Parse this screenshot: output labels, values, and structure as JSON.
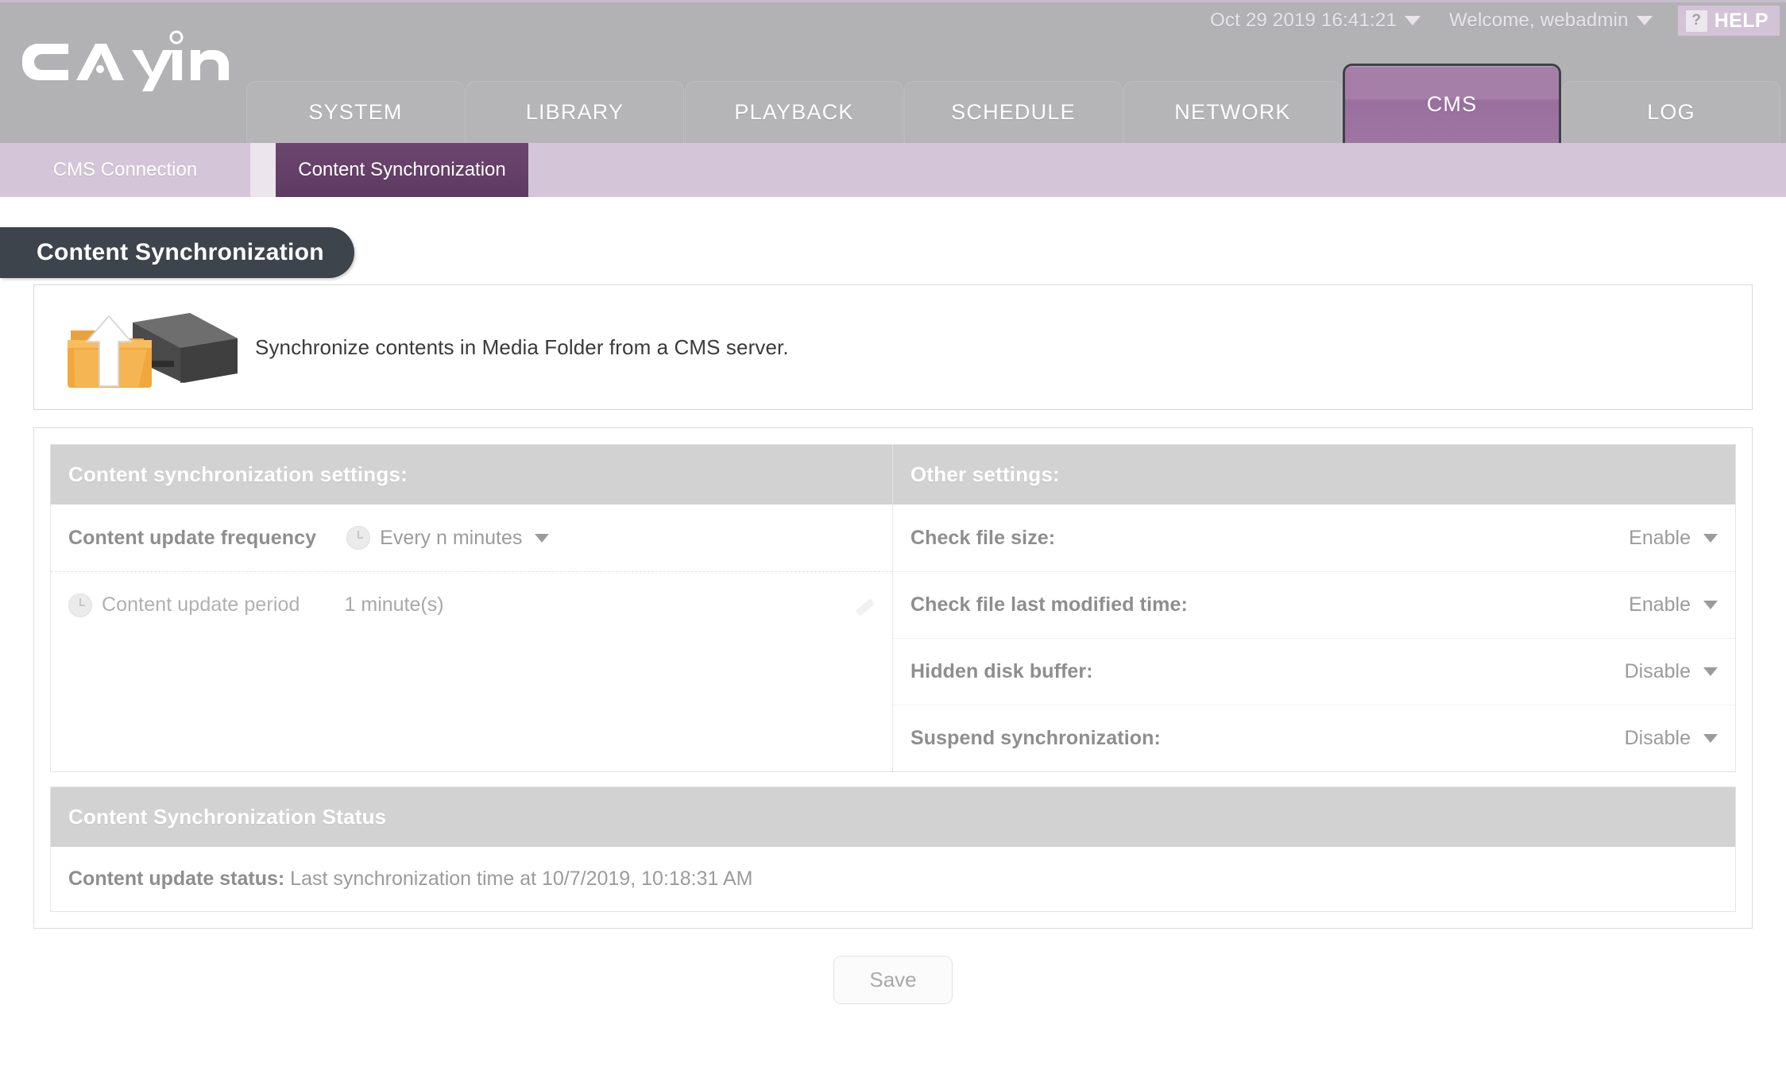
{
  "header": {
    "logo_text": "CAYiN",
    "datetime": "Oct 29 2019 16:41:21",
    "welcome": "Welcome, webadmin",
    "help_icon_glyph": "?",
    "help_label": "HELP",
    "tabs": [
      {
        "label": "SYSTEM",
        "active": false
      },
      {
        "label": "LIBRARY",
        "active": false
      },
      {
        "label": "PLAYBACK",
        "active": false
      },
      {
        "label": "SCHEDULE",
        "active": false
      },
      {
        "label": "NETWORK",
        "active": false
      },
      {
        "label": "CMS",
        "active": true
      },
      {
        "label": "LOG",
        "active": false
      }
    ]
  },
  "subnav": {
    "items": [
      {
        "label": "CMS Connection",
        "active": false
      },
      {
        "label": "Content Synchronization",
        "active": true
      }
    ]
  },
  "page": {
    "title": "Content Synchronization",
    "info_text": "Synchronize contents in Media Folder from a CMS server.",
    "info_icon": "folder-upload-server-icon"
  },
  "sync_settings": {
    "heading": "Content synchronization settings:",
    "frequency": {
      "label": "Content update frequency",
      "icon": "clock-icon",
      "value": "Every n minutes"
    },
    "period": {
      "label": "Content update period",
      "icon": "clock-icon",
      "value": "1 minute(s)",
      "edit_icon": "pencil-icon"
    }
  },
  "other_settings": {
    "heading": "Other settings:",
    "rows": [
      {
        "label": "Check file size:",
        "value": "Enable"
      },
      {
        "label": "Check file last modified time:",
        "value": "Enable"
      },
      {
        "label": "Hidden disk buffer:",
        "value": "Disable"
      },
      {
        "label": "Suspend synchronization:",
        "value": "Disable"
      }
    ]
  },
  "status": {
    "heading": "Content Synchronization Status",
    "label": "Content update status:",
    "value": "Last synchronization time at 10/7/2019, 10:18:31 AM"
  },
  "footer": {
    "save_label": "Save"
  },
  "colors": {
    "header_gray": "#b2b2b4",
    "accent_purple": "#a67fa9",
    "active_subtab_purple": "#5e3a61",
    "subnav_lavender": "#d4c5d8",
    "title_banner_dark": "#3e444c",
    "panel_head_gray": "#d2d2d2",
    "icon_orange": "#f0a030"
  }
}
